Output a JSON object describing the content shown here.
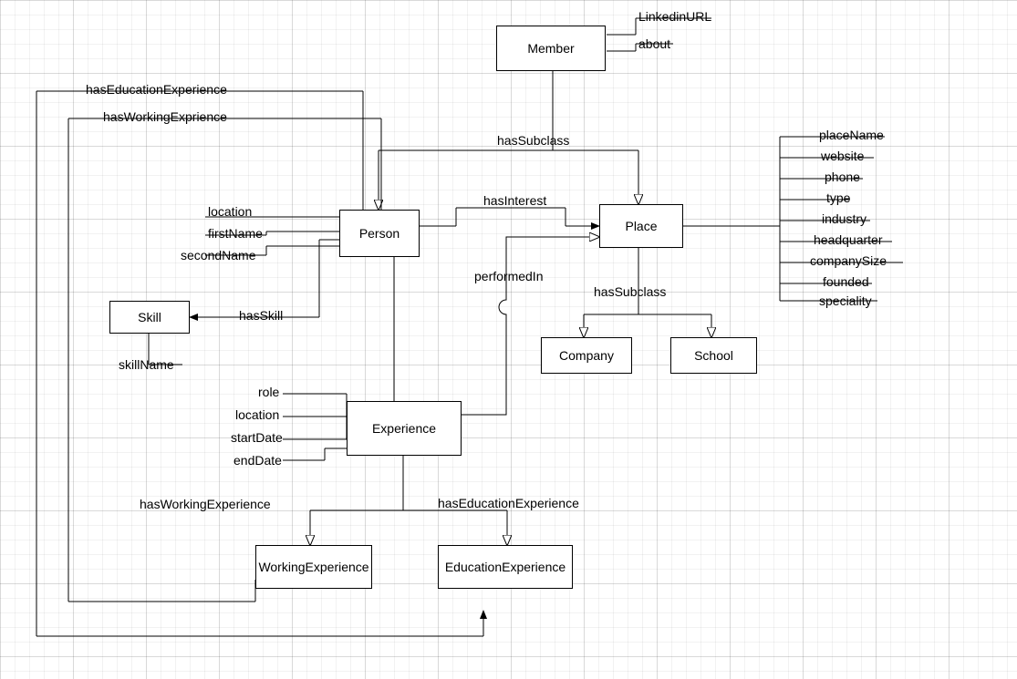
{
  "entities": {
    "member": "Member",
    "person": "Person",
    "place": "Place",
    "skill": "Skill",
    "experience": "Experience",
    "company": "Company",
    "school": "School",
    "workingExperience": "WorkingExperience",
    "educationExperience": "EducationExperience"
  },
  "relations": {
    "hasSubclass_member": "hasSubclass",
    "hasSubclass_place": "hasSubclass",
    "hasInterest": "hasInterest",
    "performedIn": "performedIn",
    "hasSkill": "hasSkill",
    "hasWorkingExperience_top": "hasWorkingExprience",
    "hasEducationExperience_top": "hasEducationExperience",
    "hasWorkingExperience_exp": "hasWorkingExperience",
    "hasEducationExperience_exp": "hasEducationExperience"
  },
  "attributes": {
    "member": {
      "linkedinURL": "LinkedinURL",
      "about": "about"
    },
    "person": {
      "location": "location",
      "firstName": "firstName",
      "secondName": "secondName"
    },
    "skill": {
      "skillName": "skillName"
    },
    "experience": {
      "role": "role",
      "location": "location",
      "startDate": "startDate",
      "endDate": "endDate"
    },
    "place": {
      "placeName": "placeName",
      "website": "website",
      "phone": "phone",
      "type": "type",
      "industry": "industry",
      "headquarter": "headquarter",
      "companySize": "companySize",
      "founded": "founded",
      "speciality": "speciality"
    }
  }
}
